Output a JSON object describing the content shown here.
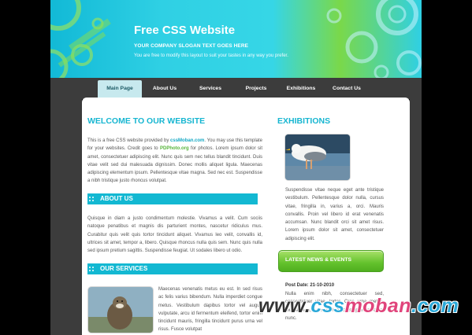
{
  "site": {
    "title": "Free CSS Website",
    "slogan": "YOUR COMPANY SLOGAN TEXT GOES HERE",
    "slogan_sub": "You are free to modify this layout to suit your tastes in any way you prefer."
  },
  "nav": {
    "items": [
      {
        "label": "Main Page",
        "active": true
      },
      {
        "label": "About Us"
      },
      {
        "label": "Services"
      },
      {
        "label": "Projects"
      },
      {
        "label": "Exhibitions"
      },
      {
        "label": "Contact Us"
      }
    ]
  },
  "main": {
    "heading": "WELCOME TO OUR WEBSITE",
    "intro_pre": "This is a free CSS website provided by ",
    "intro_link1": "cssMoban.com",
    "intro_mid": ". You may use this template for your websites. Credit goes to ",
    "intro_link2": "PDPhoto.org",
    "intro_post": " for photos. Lorem ipsum dolor sit amet, consectetuer adipiscing elit. Nunc quis sem nec tellus blandit tincidunt. Duis vitae velit sed dui malesuada dignissim. Donec mollis aliquet ligula. Maecenas adipiscing elementum ipsum. Pellentesque vitae magna. Sed nec est. Suspendisse a nibh tristique justo rhoncus volutpat.",
    "about_heading": "ABOUT US",
    "about_text": "Quisque in diam a justo condimentum molestie. Vivamus a velit. Cum sociis natoque penatibus et magnis dis parturient montes, nascetur ridiculus mus. Curabitur quis velit quis tortor tincidunt aliquet. Vivamus leo velit, convallis id, ultrices sit amet, tempor a, libero. Quisque rhoncus nulla quis sem. Nunc quis nulla sed ipsum pretium sagittis. Suspendisse feugiat. Ut sodales libero ut odio.",
    "services_heading": "OUR SERVICES",
    "services_text": "Maecenas venenatis metus eu est. In sed risus ac felis varius bibendum. Nulla imperdiet congue metus. Vestibulum dapibus tortor vel augue vulputate, arcu id fermentum eleifend, tortor enim tincidunt mauris, fringilla tincidunt purus urna vel risus. Fusce volutpat"
  },
  "sidebar": {
    "heading": "EXHIBITIONS",
    "text": "Suspendisse vitae neque eget ante tristique vestibulum. Pellentesque dolor nulla, cursus vitae, fringilla in, varius a, orci. Mauris convallis. Proin vel libero id erat venenatis accumsan. Nunc blandit orci sit amet risus. Lorem ipsum dolor sit amet, consectetuer adipiscing elit.",
    "news_button": "LATEST NEWS & EVENTS",
    "post_date": "Post Date: 21-10-2010",
    "post_text": "Nulla enim nibh, consectetuer sed, consectetuer vitae, tortor. Cras urna metus, feugiat non, consectetuer quis, pretium quis, nunc."
  },
  "watermark": {
    "www": "www.",
    "css": "css",
    "moban": "moban",
    "com": ".com"
  },
  "colors": {
    "accent": "#17b6d1",
    "green": "#63c22c",
    "dark_bar": "#3c3c3c"
  }
}
